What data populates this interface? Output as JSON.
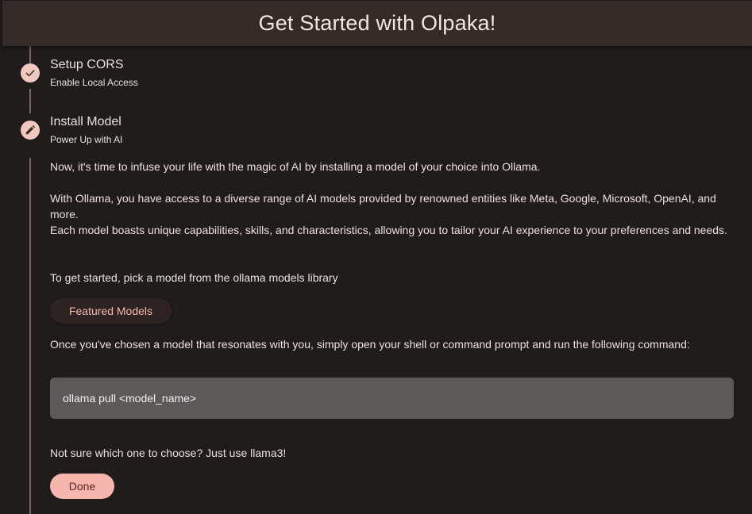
{
  "header": {
    "title": "Get Started with Olpaka!"
  },
  "steps": [
    {
      "title": "Setup CORS",
      "subtitle": "Enable Local Access",
      "icon": "check-icon",
      "state": "completed"
    },
    {
      "title": "Install Model",
      "subtitle": "Power Up with AI",
      "icon": "pencil-icon",
      "state": "editing"
    }
  ],
  "content": {
    "intro": "Now, it's time to infuse your life with the magic of AI by installing a model of your choice into Ollama.",
    "access_line": "With Ollama, you have access to a diverse range of AI models provided by renowned entities like Meta, Google, Microsoft, OpenAI, and more.",
    "capabilities_line": "Each model boasts unique capabilities, skills, and characteristics, allowing you to tailor your AI experience to your preferences and needs.",
    "get_started": "To get started, pick a model from the ollama models library",
    "featured_label": "Featured Models",
    "command_intro": "Once you've chosen a model that resonates with you, simply open your shell or command prompt and run the following command:",
    "command": "ollama pull <model_name>",
    "not_sure": "Not sure which one to choose? Just use llama3!",
    "done_label": "Done"
  },
  "colors": {
    "background": "#201c1c",
    "header": "#342a28",
    "accent": "#f2c9c1",
    "button_primary": "#f7b6ad",
    "code_background": "#5b5a59"
  }
}
